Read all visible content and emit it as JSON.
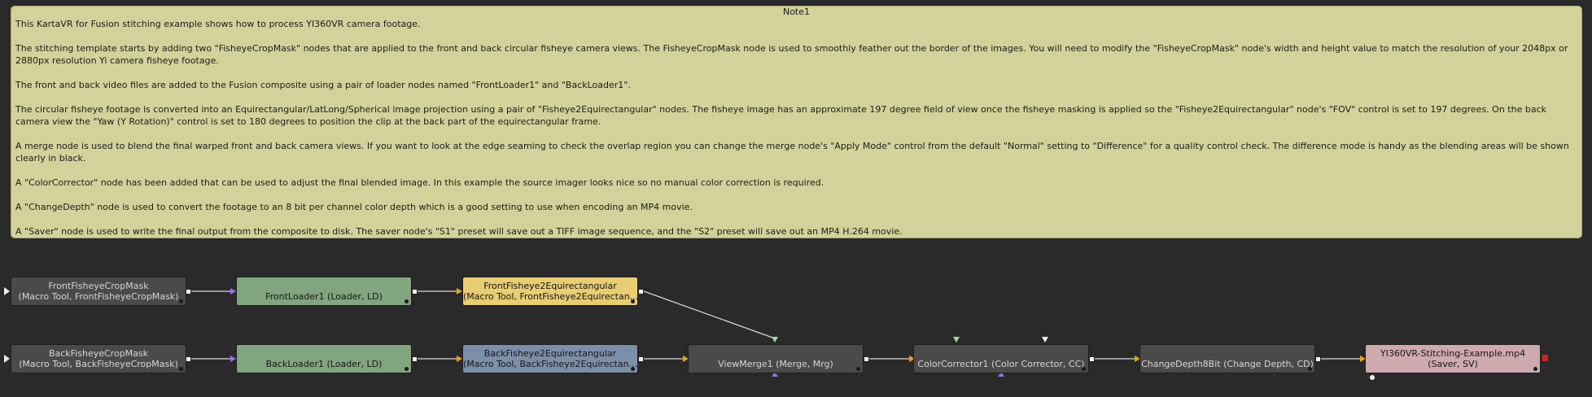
{
  "note": {
    "title": "Note1",
    "paragraphs": [
      "This KartaVR for Fusion stitching example shows how to process YI360VR camera footage.",
      "The stitching template starts by adding two \"FisheyeCropMask\" nodes that are applied to the front and back circular fisheye camera views. The FisheyeCropMask node is used to smoothly feather out the border of the images. You will need to modify the \"FisheyeCropMask\" node's width and height value to match the resolution of your 2048px or 2880px resolution Yi camera fisheye footage.",
      "The front and back video files are added to the Fusion composite using a pair of loader nodes named \"FrontLoader1\" and \"BackLoader1\".",
      "The circular fisheye footage is converted into an Equirectangular/LatLong/Spherical image projection using a pair of \"Fisheye2Equirectangular\" nodes. The fisheye image has an approximate 197 degree field of view once the fisheye masking is applied so the \"Fisheye2Equirectangular\" node's \"FOV\" control is set to 197 degrees. On the back camera view the \"Yaw (Y Rotation)\" control is set to 180 degrees to position the clip at the back part of the equirectangular frame.",
      "A merge node is used to blend the final warped front and back camera views. If you want to look at the edge seaming to check the overlap region you can change the merge node's \"Apply Mode\" control from the default \"Normal\" setting to \"Difference\" for a quality control check. The difference mode is handy as the blending areas will be shown clearly in black.",
      "A \"ColorCorrector\" node has been added that can be used to adjust the final blended image. In this example the source imager looks nice so no manual color correction is required.",
      "A \"ChangeDepth\" node is used to convert the footage to an 8 bit per channel color depth which is a good setting to use when encoding an MP4 movie.",
      "A \"Saver\" node is used to write the final output from the composite to disk. The saver node's \"S1\" preset will save out a TIFF image sequence, and the \"S2\" preset will save out an MP4 H.264 movie."
    ]
  },
  "nodes": {
    "front_crop": {
      "line1": "FrontFisheyeCropMask",
      "line2": "(Macro Tool, FrontFisheyeCropMask)"
    },
    "front_loader": {
      "line1": "FrontLoader1  (Loader, LD)"
    },
    "front_f2e": {
      "line1": "FrontFisheye2Equirectangular",
      "line2": "(Macro Tool, FrontFisheye2Equirectan..."
    },
    "back_crop": {
      "line1": "BackFisheyeCropMask",
      "line2": "(Macro Tool, BackFisheyeCropMask)"
    },
    "back_loader": {
      "line1": "BackLoader1  (Loader, LD)"
    },
    "back_f2e": {
      "line1": "BackFisheye2Equirectangular",
      "line2": "(Macro Tool, BackFisheye2Equirectan..."
    },
    "merge": {
      "line1": "ViewMerge1  (Merge, Mrg)"
    },
    "color": {
      "line1": "ColorCorrector1  (Color Corrector, CC)"
    },
    "depth": {
      "line1": "ChangeDepth8Bit  (Change Depth, CD)"
    },
    "saver": {
      "line1": "YI360VR-Stitching-Example.mp4",
      "line2": "(Saver, SV)"
    }
  },
  "colors": {
    "note_bg": "#d3d29a",
    "loader": "#81a57f",
    "front_f2e": "#e8cd72",
    "back_f2e": "#7c8fa9",
    "saver": "#ceaaaf",
    "tool": "#4a4a4a",
    "wire": "#d8d8d8",
    "input_arrow_orange": "#e8a020",
    "input_arrow_blue": "#8a78e8",
    "input_arrow_green": "#9fe09f"
  }
}
